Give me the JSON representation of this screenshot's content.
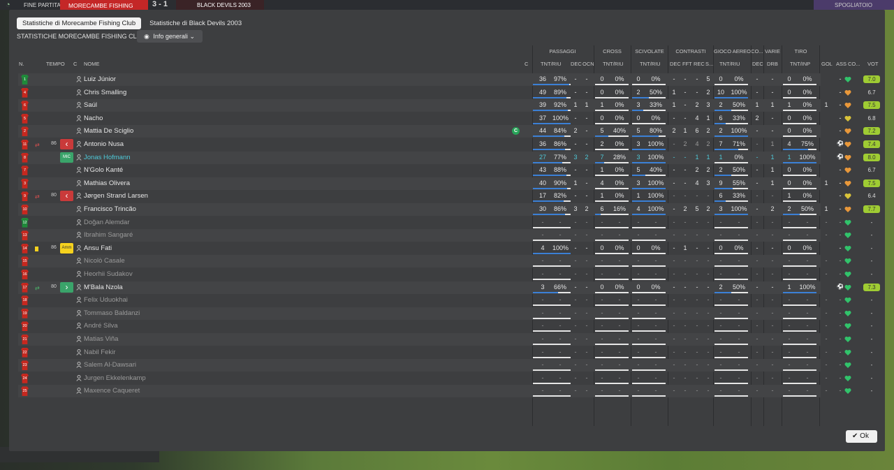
{
  "topbar": {
    "end_label": "FINE PARTITA",
    "home_team": "MORECAMBE FISHING",
    "score": "3 - 1",
    "away_team": "BLACK DEVILS 2003",
    "right_label": "SPOGLIATOIO"
  },
  "tabs": [
    "Statistiche di Morecambe Fishing Club",
    "Statistiche di Black Devils 2003"
  ],
  "subtitle": "STATISTICHE MORECAMBE FISHING CLUB",
  "dropdown_label": "Info generali",
  "group_headers": {
    "passaggi": "PASSAGGI",
    "cross": "CROSS",
    "scivolate": "SCIVOLATE",
    "contrasti": "CONTRASTI",
    "gioco_aereo": "GIOCO AEREO",
    "co": "CO...",
    "varie": "VARIE",
    "tiro": "TIRO"
  },
  "col_headers": {
    "n": "N.",
    "tempo": "TEMPO",
    "c": "C",
    "nome": "NOME",
    "c2": "C",
    "pass_tnt": "TNT/RIU",
    "dec": "DEC",
    "ocn": "OCN",
    "cross_tnt": "TNT/RIU",
    "sciv_tnt": "TNT/RIU",
    "cont_dec": "DEC",
    "fft": "FFT",
    "rec": "REC",
    "s": "S...",
    "aereo_tnt": "TNT/RIU",
    "co_dec": "DEC",
    "drb": "DRB",
    "tiro_tnt": "TNT/INP",
    "gol": "GOL",
    "ass": "ASS",
    "cond": "CO...",
    "vot": "VOT"
  },
  "colors": {
    "accent_bar": "#3b80d6",
    "rating_green": "#9fcc33",
    "home_red": "#c42727",
    "gk_green": "#1f8a3a"
  },
  "players": [
    {
      "n": "1",
      "gk": true,
      "name": "Luiz Júnior",
      "pass_t": "36",
      "pass_p": "97%",
      "pass_f": 0.97,
      "dec": "-",
      "ocn": "-",
      "cr_t": "0",
      "cr_p": "0%",
      "cr_f": 0,
      "sc_t": "0",
      "sc_p": "0%",
      "sc_f": 0,
      "cdec": "-",
      "fft": "-",
      "rec": "-",
      "s": "5",
      "ae_t": "0",
      "ae_p": "0%",
      "ae_f": 0,
      "codec": "-",
      "drb": "-",
      "ti_t": "0",
      "ti_p": "0%",
      "ti_f": 0,
      "gol": "",
      "ass": "-",
      "cond": "green",
      "vot": "7.0",
      "vgreen": true
    },
    {
      "n": "4",
      "name": "Chris Smalling",
      "pass_t": "49",
      "pass_p": "89%",
      "pass_f": 0.89,
      "dec": "-",
      "ocn": "-",
      "cr_t": "0",
      "cr_p": "0%",
      "cr_f": 0,
      "sc_t": "2",
      "sc_p": "50%",
      "sc_f": 0.5,
      "cdec": "1",
      "fft": "-",
      "rec": "-",
      "s": "2",
      "ae_t": "10",
      "ae_p": "100%",
      "ae_f": 1,
      "codec": "-",
      "drb": "-",
      "ti_t": "0",
      "ti_p": "0%",
      "ti_f": 0,
      "gol": "",
      "ass": "-",
      "cond": "orange",
      "vot": "6.7",
      "vgreen": false
    },
    {
      "n": "6",
      "name": "Saúl",
      "pass_t": "39",
      "pass_p": "92%",
      "pass_f": 0.92,
      "dec": "1",
      "ocn": "1",
      "cr_t": "1",
      "cr_p": "0%",
      "cr_f": 0,
      "sc_t": "3",
      "sc_p": "33%",
      "sc_f": 0.33,
      "cdec": "1",
      "fft": "-",
      "rec": "2",
      "s": "3",
      "ae_t": "2",
      "ae_p": "50%",
      "ae_f": 0.5,
      "codec": "1",
      "drb": "1",
      "ti_t": "1",
      "ti_p": "0%",
      "ti_f": 0,
      "gol": "1",
      "ass": "-",
      "cond": "orange",
      "vot": "7.5",
      "vgreen": true
    },
    {
      "n": "5",
      "name": "Nacho",
      "pass_t": "37",
      "pass_p": "100%",
      "pass_f": 1,
      "dec": "-",
      "ocn": "-",
      "cr_t": "0",
      "cr_p": "0%",
      "cr_f": 0,
      "sc_t": "0",
      "sc_p": "0%",
      "sc_f": 0,
      "cdec": "-",
      "fft": "-",
      "rec": "4",
      "s": "1",
      "ae_t": "6",
      "ae_p": "33%",
      "ae_f": 0.33,
      "codec": "2",
      "drb": "-",
      "ti_t": "0",
      "ti_p": "0%",
      "ti_f": 0,
      "gol": "",
      "ass": "-",
      "cond": "yellow",
      "vot": "6.8",
      "vgreen": false
    },
    {
      "n": "2",
      "name": "Mattia De Sciglio",
      "cap": true,
      "pass_t": "44",
      "pass_p": "84%",
      "pass_f": 0.84,
      "dec": "2",
      "ocn": "-",
      "cr_t": "5",
      "cr_p": "40%",
      "cr_f": 0.4,
      "sc_t": "5",
      "sc_p": "80%",
      "sc_f": 0.8,
      "cdec": "2",
      "fft": "1",
      "rec": "6",
      "s": "2",
      "ae_t": "2",
      "ae_p": "100%",
      "ae_f": 1,
      "codec": "-",
      "drb": "-",
      "ti_t": "0",
      "ti_p": "0%",
      "ti_f": 0,
      "gol": "",
      "ass": "-",
      "cond": "orange",
      "vot": "7.2",
      "vgreen": true
    },
    {
      "n": "11",
      "sub": "out",
      "min": "86",
      "badge": "out",
      "name": "Antonio Nusa",
      "pass_t": "36",
      "pass_p": "86%",
      "pass_f": 0.86,
      "dec": "-",
      "ocn": "-",
      "cr_t": "2",
      "cr_p": "0%",
      "cr_f": 0,
      "sc_t": "3",
      "sc_p": "100%",
      "sc_f": 1,
      "cdec": "-",
      "fft": "2",
      "rec": "4",
      "s": "2",
      "ae_t": "7",
      "ae_p": "71%",
      "ae_f": 0.71,
      "codec": "-",
      "drb": "1",
      "ti_t": "4",
      "ti_p": "75%",
      "ti_f": 0.75,
      "gol": "",
      "ass": "ball",
      "cond": "orange",
      "vot": "7.4",
      "vgreen": true,
      "dimrow": true
    },
    {
      "n": "8",
      "badge": "mic",
      "name": "Jonas Hofmann",
      "hl": true,
      "pass_t": "27",
      "pass_p": "77%",
      "pass_f": 0.77,
      "dec": "3",
      "ocn": "2",
      "cr_t": "7",
      "cr_p": "28%",
      "cr_f": 0.28,
      "sc_t": "3",
      "sc_p": "100%",
      "sc_f": 1,
      "cdec": "-",
      "fft": "-",
      "rec": "1",
      "s": "1",
      "ae_t": "1",
      "ae_p": "0%",
      "ae_f": 0,
      "codec": "-",
      "drb": "1",
      "ti_t": "1",
      "ti_p": "100%",
      "ti_f": 1,
      "gol": "",
      "ass": "ball",
      "cond": "orange",
      "vot": "8.0",
      "vgreen": true,
      "teal": true
    },
    {
      "n": "7",
      "name": "N'Golo Kanté",
      "pass_t": "43",
      "pass_p": "88%",
      "pass_f": 0.88,
      "dec": "-",
      "ocn": "-",
      "cr_t": "1",
      "cr_p": "0%",
      "cr_f": 0,
      "sc_t": "5",
      "sc_p": "40%",
      "sc_f": 0.4,
      "cdec": "-",
      "fft": "-",
      "rec": "2",
      "s": "2",
      "ae_t": "2",
      "ae_p": "50%",
      "ae_f": 0.5,
      "codec": "-",
      "drb": "1",
      "ti_t": "0",
      "ti_p": "0%",
      "ti_f": 0,
      "gol": "",
      "ass": "-",
      "cond": "orange",
      "vot": "6.7",
      "vgreen": false
    },
    {
      "n": "3",
      "name": "Mathias Olivera",
      "pass_t": "40",
      "pass_p": "90%",
      "pass_f": 0.9,
      "dec": "1",
      "ocn": "-",
      "cr_t": "4",
      "cr_p": "0%",
      "cr_f": 0,
      "sc_t": "3",
      "sc_p": "100%",
      "sc_f": 1,
      "cdec": "-",
      "fft": "-",
      "rec": "4",
      "s": "3",
      "ae_t": "9",
      "ae_p": "55%",
      "ae_f": 0.55,
      "codec": "-",
      "drb": "1",
      "ti_t": "0",
      "ti_p": "0%",
      "ti_f": 0,
      "gol": "1",
      "ass": "-",
      "cond": "orange",
      "vot": "7.5",
      "vgreen": true
    },
    {
      "n": "9",
      "sub": "out",
      "min": "80",
      "badge": "out",
      "name": "Jørgen Strand Larsen",
      "pass_t": "17",
      "pass_p": "82%",
      "pass_f": 0.82,
      "dec": "-",
      "ocn": "-",
      "cr_t": "1",
      "cr_p": "0%",
      "cr_f": 0,
      "sc_t": "1",
      "sc_p": "100%",
      "sc_f": 1,
      "cdec": "-",
      "fft": "-",
      "rec": "-",
      "s": "-",
      "ae_t": "6",
      "ae_p": "33%",
      "ae_f": 0.33,
      "codec": "-",
      "drb": "-",
      "ti_t": "1",
      "ti_p": "0%",
      "ti_f": 0,
      "gol": "",
      "ass": "-",
      "cond": "yellow",
      "vot": "6.4",
      "vgreen": false,
      "dimrow": true
    },
    {
      "n": "10",
      "name": "Francisco Trincão",
      "pass_t": "30",
      "pass_p": "86%",
      "pass_f": 0.86,
      "dec": "3",
      "ocn": "2",
      "cr_t": "6",
      "cr_p": "16%",
      "cr_f": 0.16,
      "sc_t": "4",
      "sc_p": "100%",
      "sc_f": 1,
      "cdec": "-",
      "fft": "2",
      "rec": "5",
      "s": "2",
      "ae_t": "3",
      "ae_p": "100%",
      "ae_f": 1,
      "codec": "-",
      "drb": "2",
      "ti_t": "2",
      "ti_p": "50%",
      "ti_f": 0.5,
      "gol": "1",
      "ass": "-",
      "cond": "orange",
      "vot": "7.7",
      "vgreen": true
    },
    {
      "n": "12",
      "gk": true,
      "name": "Doğan Alemdar",
      "empty": true,
      "cond": "green",
      "vot": "-",
      "dimrow": true
    },
    {
      "n": "13",
      "name": "Ibrahim Sangaré",
      "empty": true,
      "cond": "green",
      "vot": "-",
      "dimrow": true
    },
    {
      "n": "14",
      "sub": "card",
      "min": "86",
      "badge": "amm",
      "name": "Ansu Fati",
      "pass_t": "4",
      "pass_p": "100%",
      "pass_f": 1,
      "dec": "-",
      "ocn": "-",
      "cr_t": "0",
      "cr_p": "0%",
      "cr_f": 0,
      "sc_t": "0",
      "sc_p": "0%",
      "sc_f": 0,
      "cdec": "-",
      "fft": "1",
      "rec": "-",
      "s": "-",
      "ae_t": "0",
      "ae_p": "0%",
      "ae_f": 0,
      "codec": "-",
      "drb": "-",
      "ti_t": "0",
      "ti_p": "0%",
      "ti_f": 0,
      "gol": "",
      "ass": "-",
      "cond": "green",
      "vot": "-",
      "vgreen": false
    },
    {
      "n": "15",
      "name": "Nicolò Casale",
      "empty": true,
      "cond": "green",
      "vot": "-",
      "dimrow": true
    },
    {
      "n": "16",
      "name": "Heorhii Sudakov",
      "empty": true,
      "cond": "green",
      "vot": "-",
      "dimrow": true
    },
    {
      "n": "17",
      "sub": "in",
      "min": "80",
      "badge": "in",
      "name": "M'Bala Nzola",
      "pass_t": "3",
      "pass_p": "66%",
      "pass_f": 0.66,
      "dec": "-",
      "ocn": "-",
      "cr_t": "0",
      "cr_p": "0%",
      "cr_f": 0,
      "sc_t": "0",
      "sc_p": "0%",
      "sc_f": 0,
      "cdec": "-",
      "fft": "-",
      "rec": "-",
      "s": "-",
      "ae_t": "2",
      "ae_p": "50%",
      "ae_f": 0.5,
      "codec": "-",
      "drb": "-",
      "ti_t": "1",
      "ti_p": "100%",
      "ti_f": 1,
      "gol": "",
      "ass": "ball",
      "cond": "green",
      "vot": "7.3",
      "vgreen": true
    },
    {
      "n": "18",
      "name": "Felix Uduokhai",
      "empty": true,
      "cond": "green",
      "vot": "-",
      "dimrow": true
    },
    {
      "n": "19",
      "name": "Tommaso Baldanzi",
      "empty": true,
      "cond": "green",
      "vot": "-",
      "dimrow": true
    },
    {
      "n": "20",
      "name": "André Silva",
      "empty": true,
      "cond": "green",
      "vot": "-",
      "dimrow": true
    },
    {
      "n": "21",
      "name": "Matias Viña",
      "empty": true,
      "cond": "green",
      "vot": "-",
      "dimrow": true
    },
    {
      "n": "22",
      "name": "Nabil Fekir",
      "empty": true,
      "cond": "green",
      "vot": "-",
      "dimrow": true
    },
    {
      "n": "23",
      "name": "Salem Al-Dawsari",
      "empty": true,
      "cond": "green",
      "vot": "-",
      "dimrow": true
    },
    {
      "n": "24",
      "name": "Jurgen Ekkelenkamp",
      "empty": true,
      "cond": "green",
      "vot": "-",
      "dimrow": true
    },
    {
      "n": "25",
      "name": "Maxence Caqueret",
      "empty": true,
      "cond": "green",
      "vot": "-",
      "dimrow": true
    }
  ],
  "badges": {
    "mic": "MIC",
    "amm": "Amm",
    "out": "‹",
    "in": "›"
  },
  "ok_label": "Ok"
}
